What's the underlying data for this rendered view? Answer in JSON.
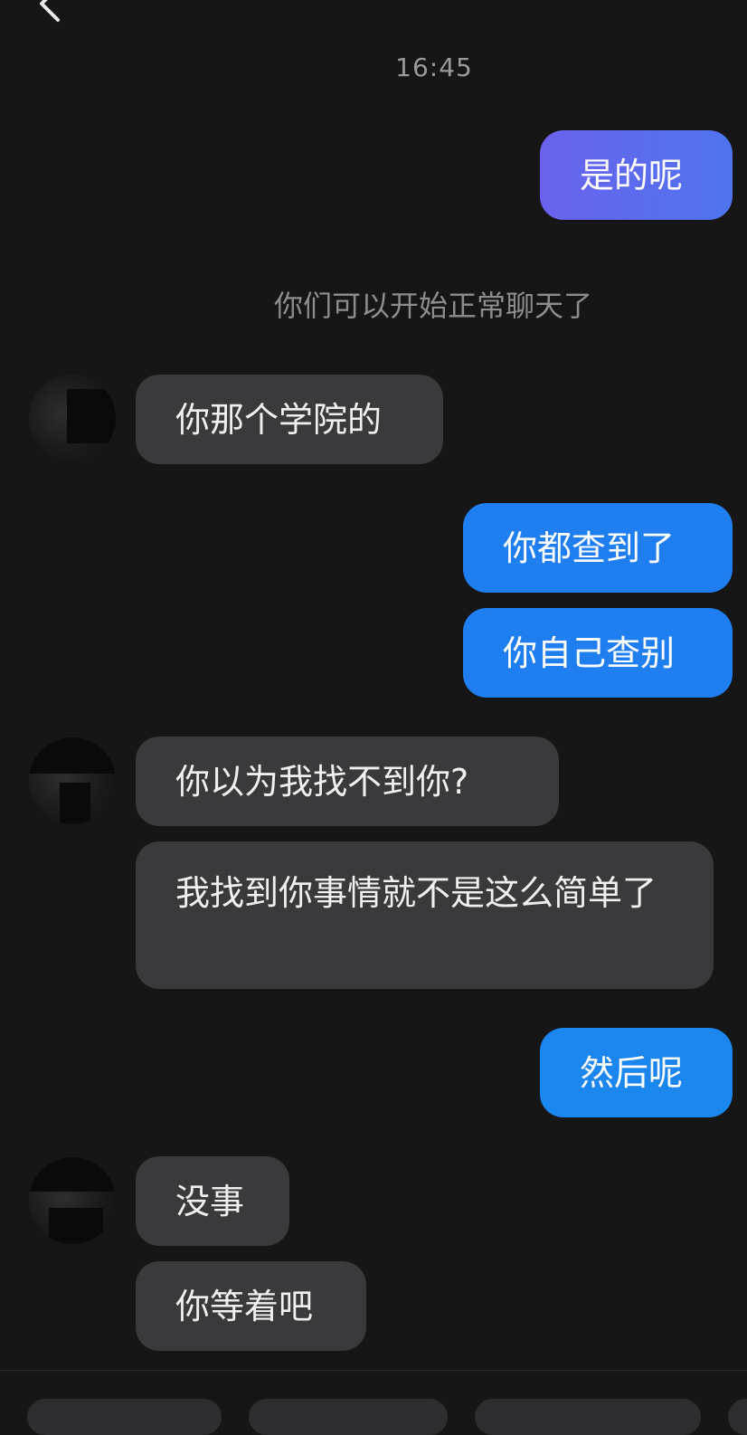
{
  "header": {
    "back_icon": "chevron-left-icon"
  },
  "timestamp": "16:45",
  "system_notice": "你们可以开始正常聊天了",
  "messages": [
    {
      "side": "out",
      "text": "是的呢",
      "color": "#5b6cf0"
    },
    {
      "side": "in",
      "text": "你那个学院的"
    },
    {
      "side": "out",
      "text": "你都查到了",
      "color": "#1f7ef0"
    },
    {
      "side": "out",
      "text": "你自己查别",
      "color": "#1f7ef0"
    },
    {
      "side": "in",
      "text": "你以为我找不到你?"
    },
    {
      "side": "in",
      "text": "我找到你事情就不是这么简单了"
    },
    {
      "side": "out",
      "text": "然后呢",
      "color": "#1a86ee"
    },
    {
      "side": "in",
      "text": "没事"
    },
    {
      "side": "in",
      "text": "你等着吧"
    }
  ],
  "colors": {
    "background": "#161617",
    "incoming_bubble": "#3a3a3c",
    "outgoing_gradient_start": "#6a62ee",
    "outgoing_blue": "#1f7ef0"
  }
}
